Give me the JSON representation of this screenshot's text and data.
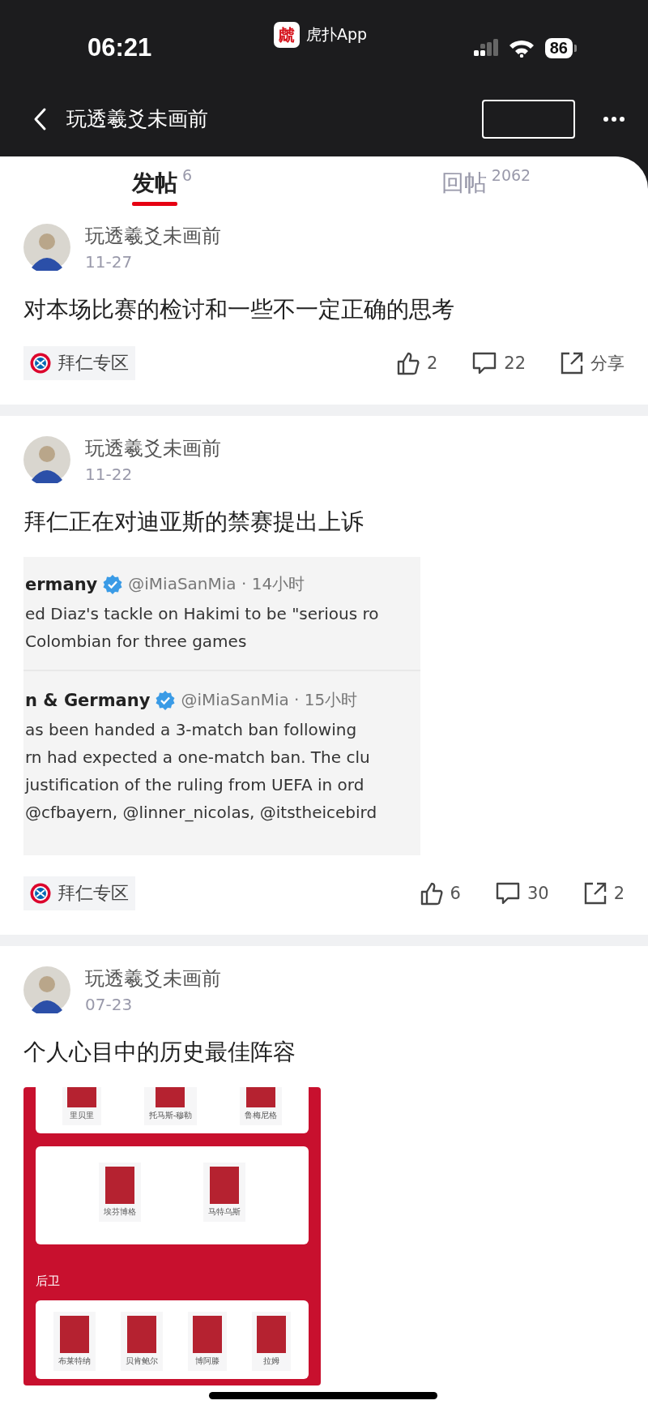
{
  "status_bar": {
    "time": "06:21",
    "app_name": "虎扑App",
    "app_icon_text": "虤",
    "battery": "86"
  },
  "nav_bar": {
    "title": "玩透羲爻未画前"
  },
  "tabs": [
    {
      "label": "发帖",
      "count": "6",
      "selected": true
    },
    {
      "label": "回帖",
      "count": "2062",
      "selected": false
    }
  ],
  "posts": [
    {
      "author": "玩透羲爻未画前",
      "date": "11-27",
      "title": "对本场比赛的检讨和一些不一定正确的思考",
      "media": {
        "kind": "none"
      },
      "tag": "拜仁专区",
      "likes": "2",
      "comments": "22",
      "share": "分享"
    },
    {
      "author": "玩透羲爻未画前",
      "date": "11-22",
      "title": "拜仁正在对迪亚斯的禁赛提出上诉",
      "media": {
        "kind": "tweets",
        "tweets": [
          {
            "name": "ermany",
            "handle": "@iMiaSanMia · 14小时",
            "lines": [
              "ed Diaz's tackle on Hakimi to be \"serious ro",
              "Colombian for three games"
            ]
          },
          {
            "name": "n & Germany",
            "handle": "@iMiaSanMia · 15小时",
            "lines": [
              "as been handed a 3-match ban following",
              "rn had expected a one-match ban. The clu",
              "justification of the ruling from UEFA in ord",
              "@cfbayern, @linner_nicolas, @itstheicebird"
            ]
          }
        ]
      },
      "tag": "拜仁专区",
      "likes": "6",
      "comments": "30",
      "share": "2"
    },
    {
      "author": "玩透羲爻未画前",
      "date": "07-23",
      "title": "个人心目中的历史最佳阵容",
      "media": {
        "kind": "lineup",
        "groups": [
          {
            "players": [
              "里贝里",
              "托马斯-穆勒",
              "鲁梅尼格"
            ]
          },
          {
            "players": [
              "埃芬博格",
              "马特乌斯"
            ]
          },
          {
            "label": "后卫",
            "players": [
              "布莱特纳",
              "贝肯鲍尔",
              "博阿滕",
              "拉姆"
            ]
          }
        ]
      }
    }
  ]
}
